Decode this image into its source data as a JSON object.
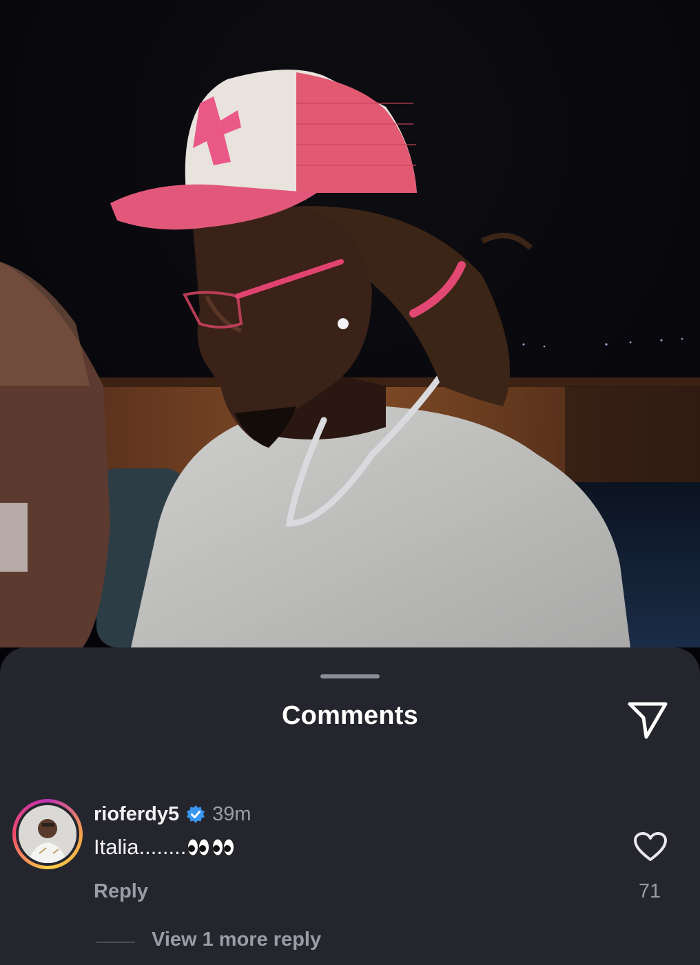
{
  "photo": {
    "description_icon": "photo"
  },
  "sheet": {
    "title": "Comments",
    "share_icon": "paper-plane-icon"
  },
  "comment": {
    "username": "rioferdy5",
    "verified_icon": "verified-badge-icon",
    "time": "39m",
    "text": "Italia........",
    "emoji": "👀👀",
    "reply_label": "Reply",
    "like_icon": "heart-icon",
    "like_count": "71",
    "view_more_label": "View 1 more reply"
  },
  "colors": {
    "sheet_bg": "#25262d",
    "text_primary": "#f2f2f4",
    "text_secondary": "#9a9ca6",
    "verified": "#3897f0"
  }
}
